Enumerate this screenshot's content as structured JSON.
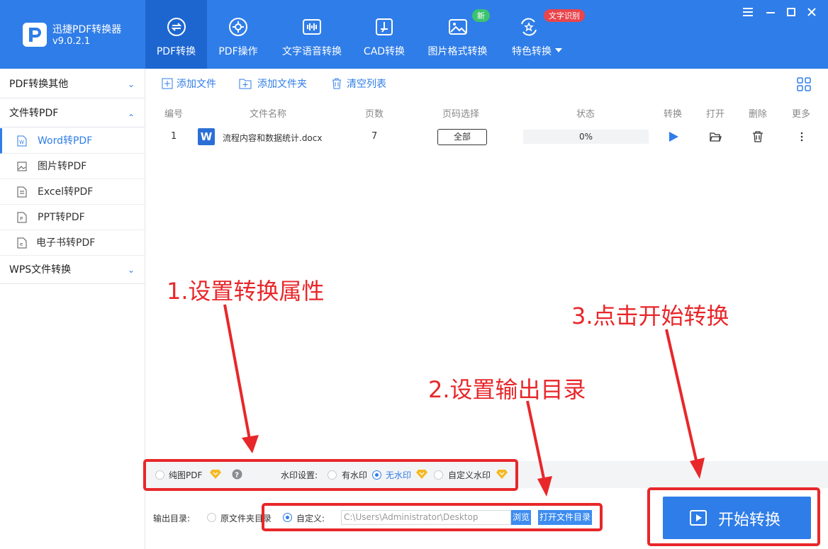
{
  "app": {
    "name": "迅捷PDF转换器",
    "version": "v9.0.2.1"
  },
  "nav": [
    {
      "label": "PDF转换",
      "icon": "convert-icon",
      "active": true
    },
    {
      "label": "PDF操作",
      "icon": "gear-icon"
    },
    {
      "label": "文字语音转换",
      "icon": "audio-wave-icon"
    },
    {
      "label": "CAD转换",
      "icon": "cad-icon"
    },
    {
      "label": "图片格式转换",
      "icon": "image-icon"
    },
    {
      "label": "特色转换",
      "icon": "star-convert-icon"
    }
  ],
  "badges": {
    "new": "新",
    "ocr": "文字识别"
  },
  "badge_colors": {
    "new": "#3cc36e",
    "ocr": "#e8454d"
  },
  "sidebar": {
    "groups": [
      {
        "label": "PDF转换其他",
        "expanded": false
      },
      {
        "label": "文件转PDF",
        "expanded": true
      },
      {
        "label": "WPS文件转换",
        "expanded": false
      }
    ],
    "items": [
      {
        "label": "Word转PDF",
        "active": true
      },
      {
        "label": "图片转PDF"
      },
      {
        "label": "Excel转PDF"
      },
      {
        "label": "PPT转PDF"
      },
      {
        "label": "电子书转PDF"
      }
    ]
  },
  "toolbar": {
    "add_file": "添加文件",
    "add_folder": "添加文件夹",
    "clear_list": "清空列表"
  },
  "table": {
    "headers": [
      "编号",
      "文件名称",
      "页数",
      "页码选择",
      "状态",
      "转换",
      "打开",
      "删除",
      "更多"
    ],
    "rows": [
      {
        "index": "1",
        "file_icon": "W",
        "name": "流程内容和数据统计.docx",
        "pages": "7",
        "page_select": "全部",
        "status": "0%"
      }
    ]
  },
  "settings": {
    "pure_image_pdf": "纯图PDF",
    "watermark_label": "水印设置:",
    "watermark_options": [
      "有水印",
      "无水印",
      "自定义水印"
    ],
    "watermark_selected": "无水印",
    "output_label": "输出目录:",
    "output_options": [
      "原文件夹目录",
      "自定义:"
    ],
    "output_selected": "自定义:",
    "output_path": "C:\\Users\\Administrator\\Desktop",
    "browse": "浏览",
    "open_folder": "打开文件目录"
  },
  "start_button": "开始转换",
  "annotations": {
    "step1": "1.设置转换属性",
    "step2": "2.设置输出目录",
    "step3": "3.点击开始转换"
  },
  "colors": {
    "primary": "#2f7de8",
    "annotation": "#e8272a"
  }
}
